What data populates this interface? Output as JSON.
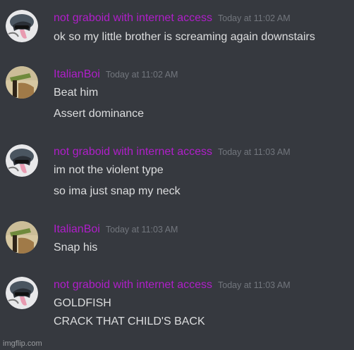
{
  "messages": [
    {
      "username": "not graboid with internet access",
      "timestamp": "Today at 11:02 AM",
      "avatar_icon": "graboid-avatar-icon",
      "lines": [
        "ok so my little brother is screaming again downstairs"
      ]
    },
    {
      "username": "ItalianBoi",
      "timestamp": "Today at 11:02 AM",
      "avatar_icon": "italianboi-avatar-icon",
      "lines": [
        "Beat him",
        "Assert dominance"
      ]
    },
    {
      "username": "not graboid with internet access",
      "timestamp": "Today at 11:03 AM",
      "avatar_icon": "graboid-avatar-icon",
      "lines": [
        "im not the violent type",
        "so ima just snap my neck"
      ]
    },
    {
      "username": "ItalianBoi",
      "timestamp": "Today at 11:03 AM",
      "avatar_icon": "italianboi-avatar-icon",
      "lines": [
        "Snap his"
      ]
    },
    {
      "username": "not graboid with internet access",
      "timestamp": "Today at 11:03 AM",
      "avatar_icon": "graboid-avatar-icon",
      "lines": [
        "GOLDFISH",
        "CRACK THAT CHILD'S BACK"
      ]
    }
  ],
  "colors": {
    "background": "#36393f",
    "username": "#b01eca",
    "timestamp": "#72767d",
    "message_text": "#dcddde"
  },
  "watermark": "imgflip.com"
}
